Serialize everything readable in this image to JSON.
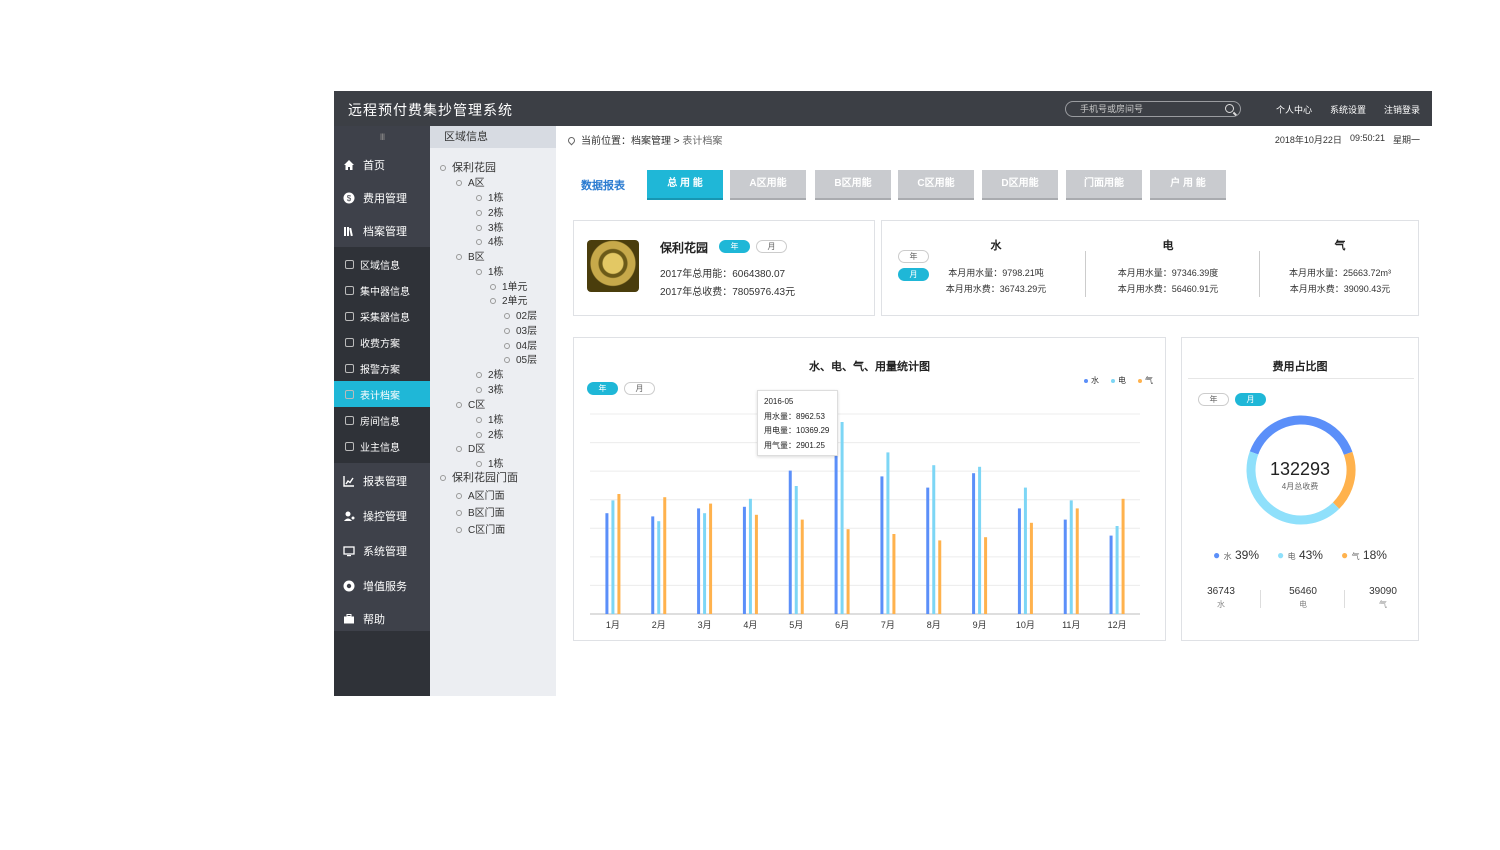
{
  "header": {
    "title": "远程预付费集抄管理系统",
    "search_placeholder": "手机号或房间号",
    "links": [
      "个人中心",
      "系统设置",
      "注销登录"
    ]
  },
  "sidebar": {
    "collapse_glyph": "III",
    "items": [
      {
        "label": "首页",
        "icon": "home-icon"
      },
      {
        "label": "费用管理",
        "icon": "dollar-icon"
      },
      {
        "label": "档案管理",
        "icon": "archive-icon"
      }
    ],
    "subitems": [
      {
        "label": "区域信息",
        "icon": "location-icon"
      },
      {
        "label": "集中器信息",
        "icon": "hub-icon"
      },
      {
        "label": "采集器信息",
        "icon": "link-icon"
      },
      {
        "label": "收费方案",
        "icon": "coin-icon"
      },
      {
        "label": "报警方案",
        "icon": "alarm-icon"
      },
      {
        "label": "表计档案",
        "icon": "folder-icon",
        "active": true
      },
      {
        "label": "房间信息",
        "icon": "house-icon"
      },
      {
        "label": "业主信息",
        "icon": "user-icon"
      }
    ],
    "items_bottom": [
      {
        "label": "报表管理",
        "icon": "chart-icon"
      },
      {
        "label": "操控管理",
        "icon": "control-icon"
      },
      {
        "label": "系统管理",
        "icon": "monitor-icon"
      },
      {
        "label": "增值服务",
        "icon": "service-icon"
      },
      {
        "label": "帮助",
        "icon": "briefcase-icon"
      }
    ]
  },
  "tree": {
    "title": "区域信息",
    "nodes": [
      "保利花园",
      "A区",
      "1栋",
      "2栋",
      "3栋",
      "4栋",
      "B区",
      "1栋",
      "1单元",
      "2单元",
      "02层",
      "03层",
      "04层",
      "05层",
      "2栋",
      "3栋",
      "C区",
      "1栋",
      "2栋",
      "D区",
      "1栋",
      "保利花园门面",
      "A区门面",
      "B区门面",
      "C区门面"
    ]
  },
  "breadcrumb": {
    "prefix": "当前位置：",
    "parent": "档案管理",
    "sep": " > ",
    "current": "表计档案"
  },
  "datetime": {
    "date": "2018年10月22日",
    "time": "09:50:21",
    "weekday": "星期一"
  },
  "report": {
    "label": "数据报表",
    "tabs": [
      "总 用 能",
      "A区用能",
      "B区用能",
      "C区用能",
      "D区用能",
      "门面用能",
      "户 用 能"
    ],
    "active_tab": 0
  },
  "summary": {
    "name": "保利花园",
    "year": "年",
    "month": "月",
    "line1": "2017年总用能：6064380.07",
    "line2": "2017年总收费：7805976.43元"
  },
  "utilities": {
    "year": "年",
    "month": "月",
    "cols": [
      {
        "title": "水",
        "usage": "本月用水量：9798.21吨",
        "fee": "本月用水费：36743.29元"
      },
      {
        "title": "电",
        "usage": "本月用水量：97346.39度",
        "fee": "本月用水费：56460.91元"
      },
      {
        "title": "气",
        "usage": "本月用水量：25663.72m³",
        "fee": "本月用水费：39090.43元"
      }
    ]
  },
  "chart": {
    "title": "水、电、气、用量统计图",
    "year": "年",
    "month": "月",
    "tooltip": {
      "title": "2016-05",
      "lines": [
        "用水量：8962.53",
        "用电量：10369.29",
        "用气量：2901.25"
      ]
    }
  },
  "chart_data": {
    "type": "bar",
    "categories": [
      "1月",
      "2月",
      "3月",
      "4月",
      "5月",
      "6月",
      "7月",
      "8月",
      "9月",
      "10月",
      "11月",
      "12月"
    ],
    "series": [
      {
        "name": "水",
        "color": "#5b8ff9",
        "values": [
          6300,
          6100,
          6600,
          6700,
          8962.53,
          10300,
          8600,
          7900,
          8800,
          6600,
          5900,
          4900
        ]
      },
      {
        "name": "电",
        "color": "#7dd6f5",
        "values": [
          7100,
          5800,
          6300,
          7200,
          8000,
          12000,
          10100,
          9300,
          9200,
          7900,
          7100,
          5500
        ]
      },
      {
        "name": "气",
        "color": "#ffb24d",
        "values": [
          7500,
          7300,
          6900,
          6200,
          5900,
          5300,
          5000,
          4600,
          4800,
          5700,
          6600,
          7200
        ]
      }
    ],
    "tooltip_category": "5月",
    "ylim": [
      0,
      12500
    ]
  },
  "fee_ratio": {
    "title": "费用占比图",
    "year": "年",
    "month": "月",
    "total": "132293",
    "total_label": "4月总收费",
    "slices": [
      {
        "name": "水",
        "pct": 39,
        "pct_label": "39%",
        "color": "#5b8ff9"
      },
      {
        "name": "电",
        "pct": 43,
        "pct_label": "43%",
        "color": "#8fe0fb"
      },
      {
        "name": "气",
        "pct": 18,
        "pct_label": "18%",
        "color": "#ffb24d"
      }
    ],
    "amounts": [
      {
        "value": "36743",
        "label": "水"
      },
      {
        "value": "56460",
        "label": "电"
      },
      {
        "value": "39090",
        "label": "气"
      }
    ]
  }
}
